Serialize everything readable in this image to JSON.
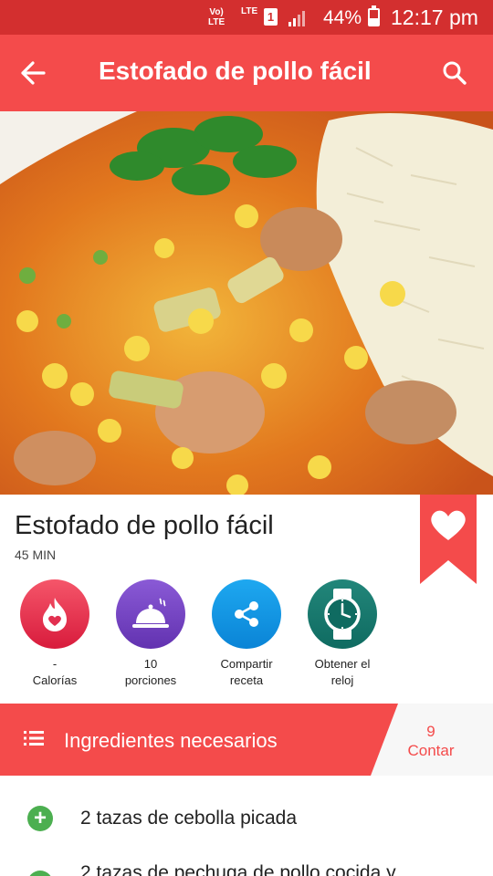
{
  "status_bar": {
    "volte": "Vo)\nLTE",
    "network": "LTE",
    "sim": "1",
    "battery": "44%",
    "time": "12:17 pm"
  },
  "app_bar": {
    "title": "Estofado de pollo fácil",
    "back_icon": "arrow-back-icon",
    "search_icon": "search-icon"
  },
  "recipe": {
    "title": "Estofado de pollo fácil",
    "time": "45 MIN",
    "favorite_icon": "heart-icon"
  },
  "actions": [
    {
      "icon": "flame-heart-icon",
      "value": "-",
      "label": "Calorías"
    },
    {
      "icon": "cloche-icon",
      "value": "10",
      "label": "porciones"
    },
    {
      "icon": "share-icon",
      "value": "Compartir",
      "label": "receta"
    },
    {
      "icon": "watch-icon",
      "value": "Obtener el",
      "label": "reloj"
    }
  ],
  "ingredients": {
    "header": "Ingredientes necesarios",
    "count": "9",
    "count_label": "Contar",
    "items": [
      "2 tazas de cebolla picada",
      "2 tazas de pechuga de pollo cocida y"
    ]
  },
  "colors": {
    "app_bar": "#f44b4b",
    "status_bar": "#d32f2f",
    "add_button": "#4caf50"
  }
}
